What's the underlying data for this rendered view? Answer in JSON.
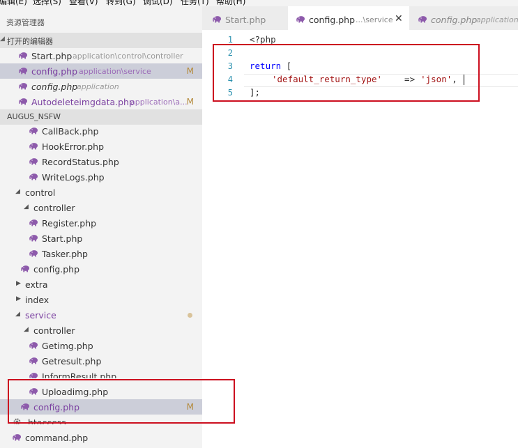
{
  "menu": [
    {
      "label": "编辑(E)"
    },
    {
      "label": "选择(S)"
    },
    {
      "label": "查看(V)"
    },
    {
      "label": "转到(G)"
    },
    {
      "label": "调试(D)"
    },
    {
      "label": "任务(T)"
    },
    {
      "label": "帮助(H)"
    }
  ],
  "sidebar": {
    "title": "资源管理器",
    "open_editors": {
      "label": "打开的编辑器",
      "items": [
        {
          "name": "Start.php",
          "path": "application\\control\\controller",
          "badge": ""
        },
        {
          "name": "config.php",
          "path": "application\\service",
          "badge": "M"
        },
        {
          "name": "config.php",
          "path": "application",
          "badge": ""
        },
        {
          "name": "Autodeleteimgdata.php",
          "path": "application\\a...",
          "badge": "M"
        }
      ]
    },
    "project": {
      "label": "AUGUS_NSFW",
      "rows": [
        {
          "name": "CallBack.php"
        },
        {
          "name": "HookError.php"
        },
        {
          "name": "RecordStatus.php"
        },
        {
          "name": "WriteLogs.php"
        },
        {
          "name": "control"
        },
        {
          "name": "controller"
        },
        {
          "name": "Register.php"
        },
        {
          "name": "Start.php"
        },
        {
          "name": "Tasker.php"
        },
        {
          "name": "config.php"
        },
        {
          "name": "extra"
        },
        {
          "name": "index"
        },
        {
          "name": "service"
        },
        {
          "name": "controller"
        },
        {
          "name": "Getimg.php"
        },
        {
          "name": "Getresult.php"
        },
        {
          "name": "InformResult.php"
        },
        {
          "name": "Uploadimg.php"
        },
        {
          "name": "config.php",
          "badge": "M"
        },
        {
          "name": ".htaccess"
        },
        {
          "name": "command.php"
        }
      ]
    }
  },
  "tabs": [
    {
      "label": "Start.php",
      "path": ""
    },
    {
      "label": "config.php",
      "path": "...\\service",
      "close": "✕"
    },
    {
      "label": "config.php",
      "path": "application"
    }
  ],
  "editor": {
    "lines": [
      {
        "n": "1",
        "t": "<?php"
      },
      {
        "n": "2",
        "t": ""
      },
      {
        "n": "3",
        "kw": "return",
        "rest": " ["
      },
      {
        "n": "4",
        "key": "'default_return_type'",
        "arrow": "=>",
        "val": "'json'",
        "tail": ","
      },
      {
        "n": "5",
        "t": "];"
      }
    ]
  },
  "colors": {
    "accent_purple": "#7a3fa0",
    "highlight_red": "#cc0f1f",
    "selection": "#ccced9",
    "modified": "#b48a3c"
  },
  "icons": {
    "php_file": "elephant-icon",
    "htaccess": "gear-icon"
  }
}
